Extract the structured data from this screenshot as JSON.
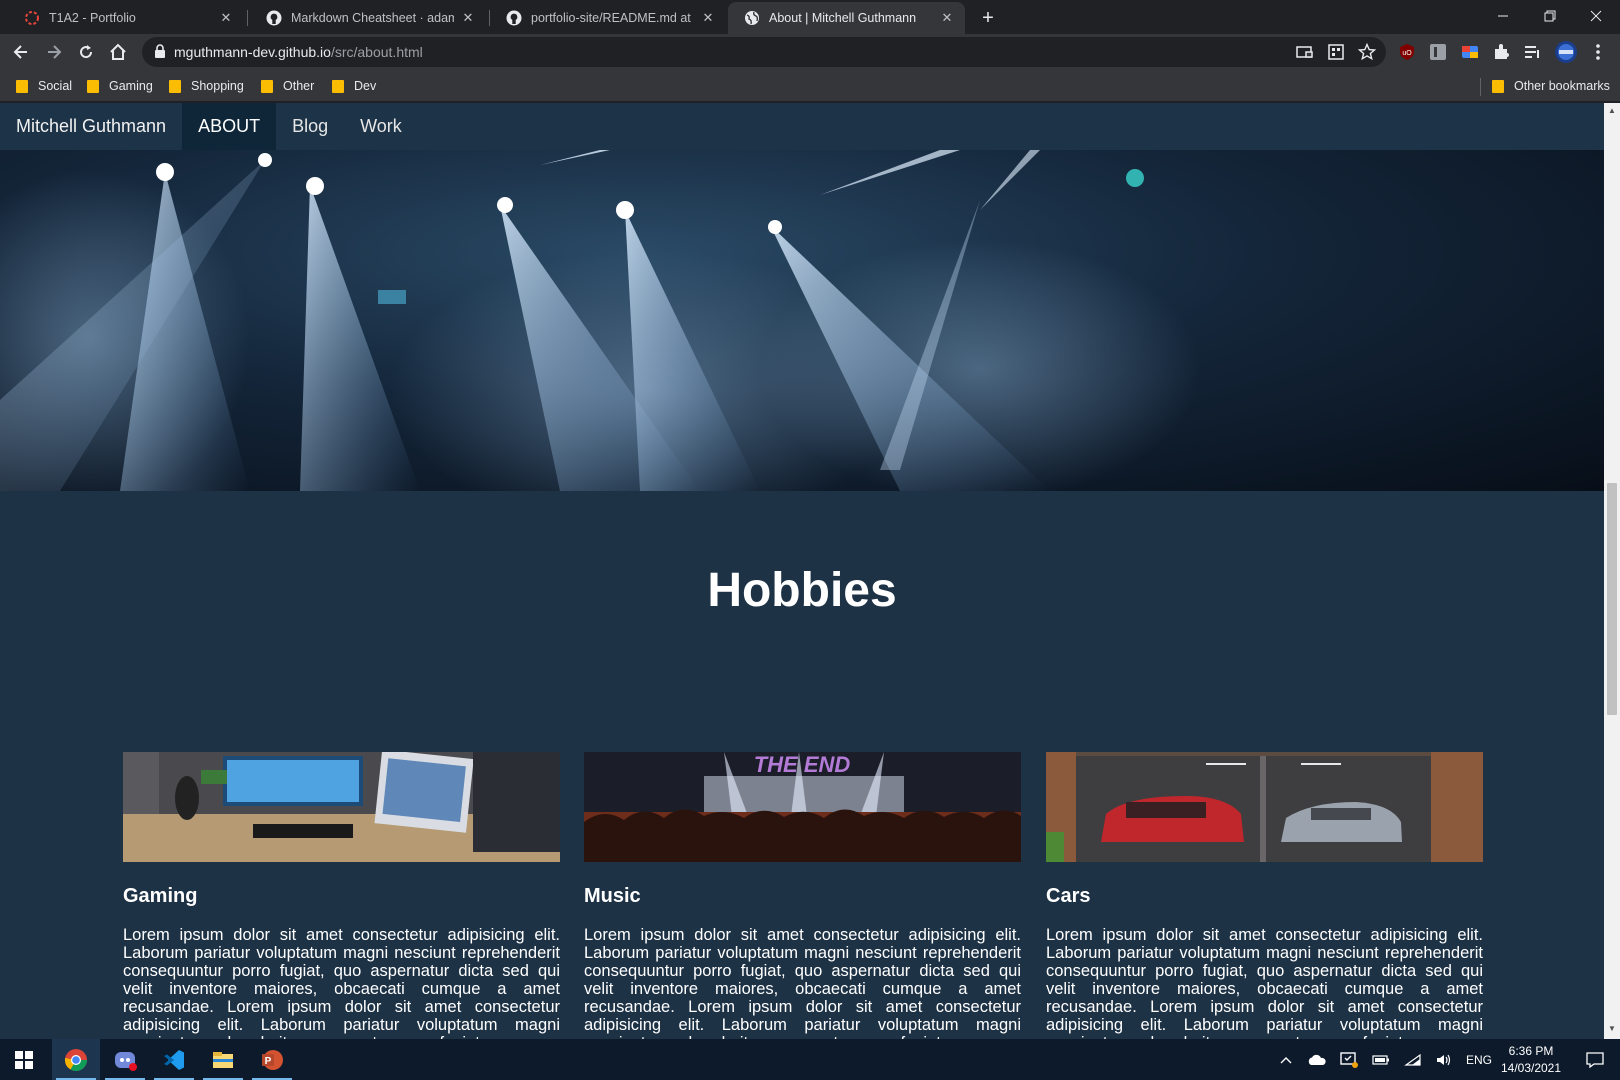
{
  "browser": {
    "tabs": [
      {
        "title": "T1A2 - Portfolio",
        "icon": "circle-spinner-icon"
      },
      {
        "title": "Markdown Cheatsheet · adam-p/",
        "icon": "github-icon"
      },
      {
        "title": "portfolio-site/README.md at ma",
        "icon": "github-icon"
      },
      {
        "title": "About | Mitchell Guthmann",
        "icon": "globe-icon"
      }
    ],
    "url_host": "mguthmann-dev.github.io",
    "url_path": "/src/about.html",
    "bookmarks": [
      "Social",
      "Gaming",
      "Shopping",
      "Other",
      "Dev"
    ],
    "other_bookmarks": "Other bookmarks"
  },
  "site": {
    "brand": "Mitchell Guthmann",
    "nav": [
      "ABOUT",
      "Blog",
      "Work"
    ],
    "active_nav": "ABOUT",
    "heading": "Hobbies",
    "cards": [
      {
        "title": "Gaming",
        "text": "Lorem ipsum dolor sit amet consectetur adipisicing elit. Laborum pariatur voluptatum magni nesciunt reprehenderit consequuntur porro fugiat, quo aspernatur dicta sed qui velit inventore maiores, obcaecati cumque a amet recusandae. Lorem ipsum dolor sit amet consectetur adipisicing elit. Laborum pariatur voluptatum magni nesciunt reprehenderit consequuntur porro fugiat."
      },
      {
        "title": "Music",
        "text": "Lorem ipsum dolor sit amet consectetur adipisicing elit. Laborum pariatur voluptatum magni nesciunt reprehenderit consequuntur porro fugiat, quo aspernatur dicta sed qui velit inventore maiores, obcaecati cumque a amet recusandae. Lorem ipsum dolor sit amet consectetur adipisicing elit. Laborum pariatur voluptatum magni nesciunt reprehenderit consequuntur porro fugiat."
      },
      {
        "title": "Cars",
        "text": "Lorem ipsum dolor sit amet consectetur adipisicing elit. Laborum pariatur voluptatum magni nesciunt reprehenderit consequuntur porro fugiat, quo aspernatur dicta sed qui velit inventore maiores, obcaecati cumque a amet recusandae. Lorem ipsum dolor sit amet consectetur adipisicing elit. Laborum pariatur voluptatum magni nesciunt reprehenderit consequuntur porro fugiat."
      }
    ],
    "music_sign": "THE END"
  },
  "taskbar": {
    "apps": [
      "windows-start-icon",
      "chrome-icon",
      "discord-icon",
      "vscode-icon",
      "file-explorer-icon",
      "powerpoint-icon"
    ],
    "language": "ENG",
    "time": "6:36 PM",
    "date": "14/03/2021"
  },
  "colors": {
    "page_bg": "#1e3246",
    "nav_active": "#0f2538",
    "chrome_dark": "#202124",
    "chrome_toolbar": "#35363a"
  }
}
